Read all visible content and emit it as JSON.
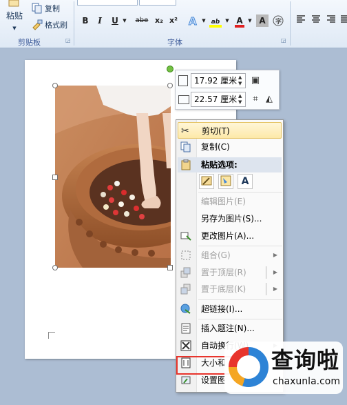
{
  "ribbon": {
    "clipboard": {
      "paste_label": "粘贴",
      "copy_label": "复制",
      "format_painter_label": "格式刷",
      "group_title": "剪贴板"
    },
    "font": {
      "group_title": "字体",
      "bold": "B",
      "italic": "I",
      "underline": "U",
      "strikethrough": "abe",
      "subscript": "x₂",
      "superscript": "x²",
      "highlight": "ab",
      "font_color": "A"
    }
  },
  "size_toolbar": {
    "height_value": "17.92 厘米",
    "width_value": "22.57 厘米"
  },
  "context_menu": {
    "items": [
      {
        "label": "剪切(T)",
        "icon": "scissors-icon",
        "enabled": true
      },
      {
        "label": "复制(C)",
        "icon": "copy-icon",
        "enabled": true
      },
      {
        "label": "粘贴选项:",
        "icon": "paste-icon",
        "enabled": true
      },
      {
        "label": "编辑图片(E)",
        "icon": "",
        "enabled": false
      },
      {
        "label": "另存为图片(S)...",
        "icon": "",
        "enabled": true
      },
      {
        "label": "更改图片(A)...",
        "icon": "change-picture-icon",
        "enabled": true
      },
      {
        "label": "组合(G)",
        "icon": "group-icon",
        "enabled": false
      },
      {
        "label": "置于顶层(R)",
        "icon": "bring-front-icon",
        "enabled": false
      },
      {
        "label": "置于底层(K)",
        "icon": "send-back-icon",
        "enabled": false
      },
      {
        "label": "超链接(I)...",
        "icon": "hyperlink-icon",
        "enabled": true
      },
      {
        "label": "插入题注(N)...",
        "icon": "caption-icon",
        "enabled": true
      },
      {
        "label": "自动换行(W)",
        "icon": "wrap-icon",
        "enabled": true
      },
      {
        "label": "大小和",
        "icon": "size-icon",
        "enabled": true
      },
      {
        "label": "设置图",
        "icon": "format-icon",
        "enabled": true
      }
    ],
    "paste_buttons": [
      "keep-source-icon",
      "picture-icon",
      "text-only-icon"
    ],
    "paste_text_glyph": "A"
  },
  "watermark": {
    "title": "查询啦",
    "domain": "chaxunla.com"
  },
  "colors": {
    "highlight_yellow": "#fde9a9",
    "annotation_red": "#e8342c",
    "font_color_red": "#e02020"
  }
}
